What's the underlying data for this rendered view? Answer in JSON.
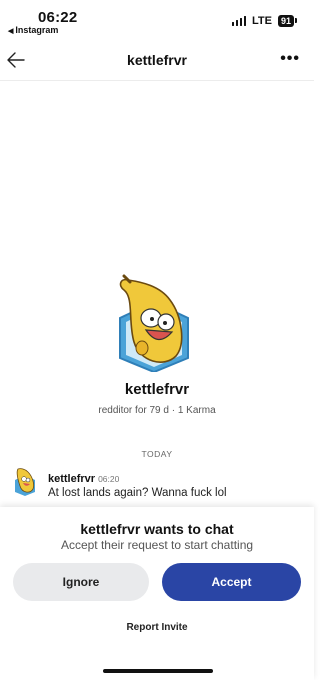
{
  "status_bar": {
    "time": "06:22",
    "back_app": "Instagram",
    "network": "LTE",
    "battery": "91"
  },
  "header": {
    "title": "kettlefrvr",
    "more": "•••"
  },
  "profile": {
    "name": "kettlefrvr",
    "meta": "redditor for 79 d · 1 Karma"
  },
  "chat": {
    "day_divider": "TODAY",
    "message": {
      "user": "kettlefrvr",
      "time": "06:20",
      "text": "At lost lands again? Wanna fuck lol"
    }
  },
  "invite_sheet": {
    "title": "kettlefrvr wants to chat",
    "subtitle": "Accept their request to start chatting",
    "ignore_label": "Ignore",
    "accept_label": "Accept",
    "report_label": "Report Invite"
  },
  "colors": {
    "accept": "#2a45a5",
    "ignore": "#e9eaec",
    "avatar_fill": "#f0c83a",
    "avatar_hex": "#4ba3d8"
  }
}
